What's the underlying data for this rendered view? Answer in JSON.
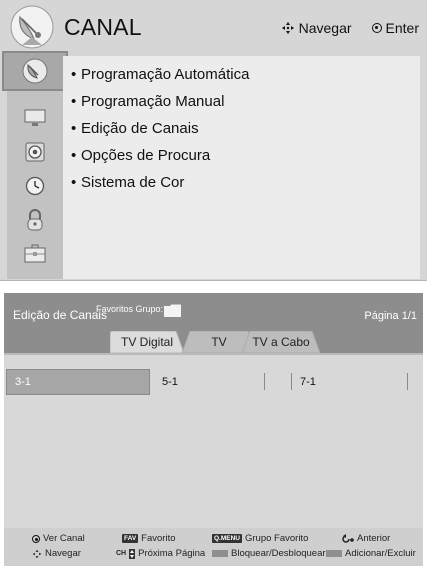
{
  "menu": {
    "title": "CANAL",
    "hints": {
      "navigate": "Navegar",
      "enter": "Enter"
    },
    "sidebar_icons": [
      "satellite-icon",
      "monitor-icon",
      "speaker-icon",
      "clock-icon",
      "lock-icon",
      "briefcase-icon"
    ],
    "items": [
      "Programação Automática",
      "Programação Manual",
      "Edição de Canais",
      "Opções de Procura",
      "Sistema de Cor"
    ]
  },
  "edit": {
    "title": "Edição de Canais",
    "favorites_label": "Favoritos Grupo:",
    "page": "Página 1/1",
    "tabs": [
      "TV Digital",
      "TV",
      "TV a Cabo"
    ],
    "active_tab": "TV Digital",
    "channels": [
      "3-1",
      "5-1",
      "7-1"
    ],
    "selected_channel": "3-1",
    "footer": {
      "view_channel": "Ver Canal",
      "favorite_key": "FAV",
      "favorite": "Favorito",
      "qmenu_key": "Q.MENU",
      "favorite_group": "Grupo Favorito",
      "previous": "Anterior",
      "navigate": "Navegar",
      "ch_key": "CH",
      "next_page": "Próxima Página",
      "lock_unlock": "Bloquear/Desbloquear",
      "add_delete": "Adicionar/Excluir"
    }
  }
}
